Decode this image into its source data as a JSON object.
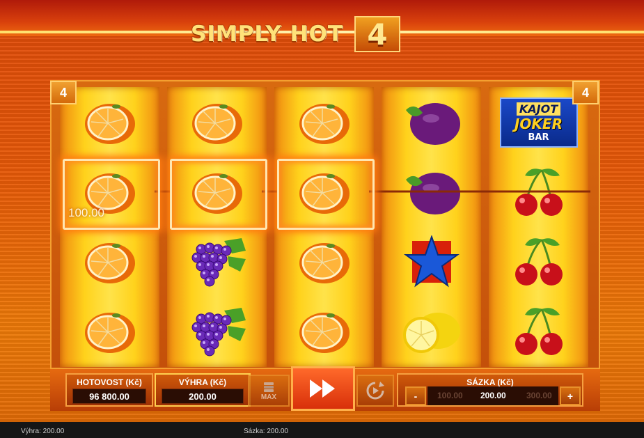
{
  "title": {
    "text": "SIMPLY HOT",
    "number": "4"
  },
  "paylines": {
    "left_badge": "4",
    "right_badge": "4"
  },
  "reels": [
    [
      "orange",
      "orange",
      "orange",
      "orange"
    ],
    [
      "orange",
      "orange",
      "grapes",
      "grapes"
    ],
    [
      "orange",
      "orange",
      "orange",
      "orange"
    ],
    [
      "plum",
      "plum",
      "star",
      "lemon"
    ],
    [
      "joker",
      "cherry",
      "cherry",
      "cherry"
    ]
  ],
  "joker_symbol": {
    "line1": "KAJOT",
    "line2": "JOKER",
    "line3": "BAR"
  },
  "win_amount": "100.00",
  "panels": {
    "cash_label": "HOTOVOST (Kč)",
    "cash_value": "96 800.00",
    "win_label": "VÝHRA (Kč)",
    "win_value": "200.00",
    "max_label": "MAX",
    "stake_label": "SÁZKA (Kč)",
    "stake_minus": "-",
    "stake_plus": "+",
    "stake_options": [
      "100.00",
      "200.00",
      "300.00"
    ]
  },
  "status_bar": {
    "win": "Výhra: 200.00",
    "stake": "Sázka: 200.00"
  },
  "colors": {
    "accent": "#ffe27a",
    "highlight": "#ff7a10"
  }
}
